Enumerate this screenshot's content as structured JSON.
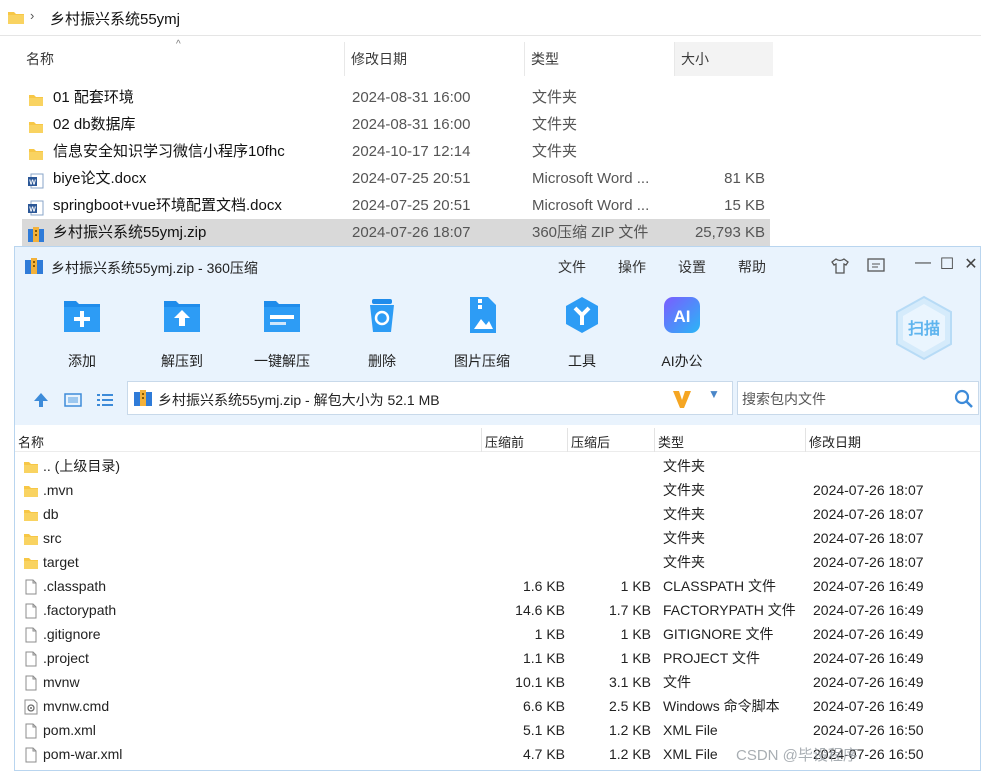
{
  "explorer": {
    "breadcrumb": "乡村振兴系统55ymj",
    "columns": [
      "名称",
      "修改日期",
      "类型",
      "大小"
    ],
    "rows": [
      {
        "icon": "folder-icon",
        "name": "01 配套环境",
        "date": "2024-08-31 16:00",
        "type": "文件夹",
        "size": ""
      },
      {
        "icon": "folder-icon",
        "name": "02 db数据库",
        "date": "2024-08-31 16:00",
        "type": "文件夹",
        "size": ""
      },
      {
        "icon": "folder-icon",
        "name": "信息安全知识学习微信小程序10fhc",
        "date": "2024-10-17 12:14",
        "type": "文件夹",
        "size": ""
      },
      {
        "icon": "word-doc-icon",
        "name": "biye论文.docx",
        "date": "2024-07-25 20:51",
        "type": "Microsoft Word ...",
        "size": "81 KB"
      },
      {
        "icon": "word-doc-icon",
        "name": "springboot+vue环境配置文档.docx",
        "date": "2024-07-25 20:51",
        "type": "Microsoft Word ...",
        "size": "15 KB"
      },
      {
        "icon": "zip-archive-icon",
        "name": "乡村振兴系统55ymj.zip",
        "date": "2024-07-26 18:07",
        "type": "360压缩 ZIP 文件",
        "size": "25,793 KB"
      }
    ]
  },
  "zip_window": {
    "title": "乡村振兴系统55ymj.zip - 360压缩",
    "menu": [
      "文件",
      "操作",
      "设置",
      "帮助"
    ],
    "toolbar": [
      {
        "label": "添加",
        "icon": "add-icon"
      },
      {
        "label": "解压到",
        "icon": "extract-to-icon"
      },
      {
        "label": "一键解压",
        "icon": "one-click-extract-icon"
      },
      {
        "label": "删除",
        "icon": "delete-icon"
      },
      {
        "label": "图片压缩",
        "icon": "image-compress-icon"
      },
      {
        "label": "工具",
        "icon": "tools-icon"
      },
      {
        "label": "AI办公",
        "icon": "ai-office-icon"
      }
    ],
    "scan_label": "扫描",
    "ai_badge": "AI",
    "address": "乡村振兴系统55ymj.zip - 解包大小为 52.1 MB",
    "search_placeholder": "搜索包内文件",
    "columns": [
      "名称",
      "压缩前",
      "压缩后",
      "类型",
      "修改日期"
    ],
    "rows": [
      {
        "icon": "folder-icon",
        "name": ".. (上级目录)",
        "packed": "",
        "orig": "",
        "type": "文件夹",
        "date": ""
      },
      {
        "icon": "folder-icon",
        "name": ".mvn",
        "packed": "",
        "orig": "",
        "type": "文件夹",
        "date": "2024-07-26 18:07"
      },
      {
        "icon": "folder-icon",
        "name": "db",
        "packed": "",
        "orig": "",
        "type": "文件夹",
        "date": "2024-07-26 18:07"
      },
      {
        "icon": "folder-icon",
        "name": "src",
        "packed": "",
        "orig": "",
        "type": "文件夹",
        "date": "2024-07-26 18:07"
      },
      {
        "icon": "folder-icon",
        "name": "target",
        "packed": "",
        "orig": "",
        "type": "文件夹",
        "date": "2024-07-26 18:07"
      },
      {
        "icon": "file-icon",
        "name": ".classpath",
        "packed": "1.6 KB",
        "orig": "1 KB",
        "type": "CLASSPATH 文件",
        "date": "2024-07-26 16:49"
      },
      {
        "icon": "file-icon",
        "name": ".factorypath",
        "packed": "14.6 KB",
        "orig": "1.7 KB",
        "type": "FACTORYPATH 文件",
        "date": "2024-07-26 16:49"
      },
      {
        "icon": "file-icon",
        "name": ".gitignore",
        "packed": "1 KB",
        "orig": "1 KB",
        "type": "GITIGNORE 文件",
        "date": "2024-07-26 16:49"
      },
      {
        "icon": "file-icon",
        "name": ".project",
        "packed": "1.1 KB",
        "orig": "1 KB",
        "type": "PROJECT 文件",
        "date": "2024-07-26 16:49"
      },
      {
        "icon": "file-icon",
        "name": "mvnw",
        "packed": "10.1 KB",
        "orig": "3.1 KB",
        "type": "文件",
        "date": "2024-07-26 16:49"
      },
      {
        "icon": "script-file-icon",
        "name": "mvnw.cmd",
        "packed": "6.6 KB",
        "orig": "2.5 KB",
        "type": "Windows 命令脚本",
        "date": "2024-07-26 16:49"
      },
      {
        "icon": "file-icon",
        "name": "pom.xml",
        "packed": "5.1 KB",
        "orig": "1.2 KB",
        "type": "XML File",
        "date": "2024-07-26 16:50"
      },
      {
        "icon": "file-icon",
        "name": "pom-war.xml",
        "packed": "4.7 KB",
        "orig": "1.2 KB",
        "type": "XML File",
        "date": "2024-07-26 16:50"
      }
    ]
  },
  "watermark": "CSDN @毕设程序",
  "colors": {
    "accent": "#1f8ceb",
    "folder": "#f7c746",
    "toolbar_bg": "#e9f3fd",
    "selected_row": "#d9d9d9"
  }
}
